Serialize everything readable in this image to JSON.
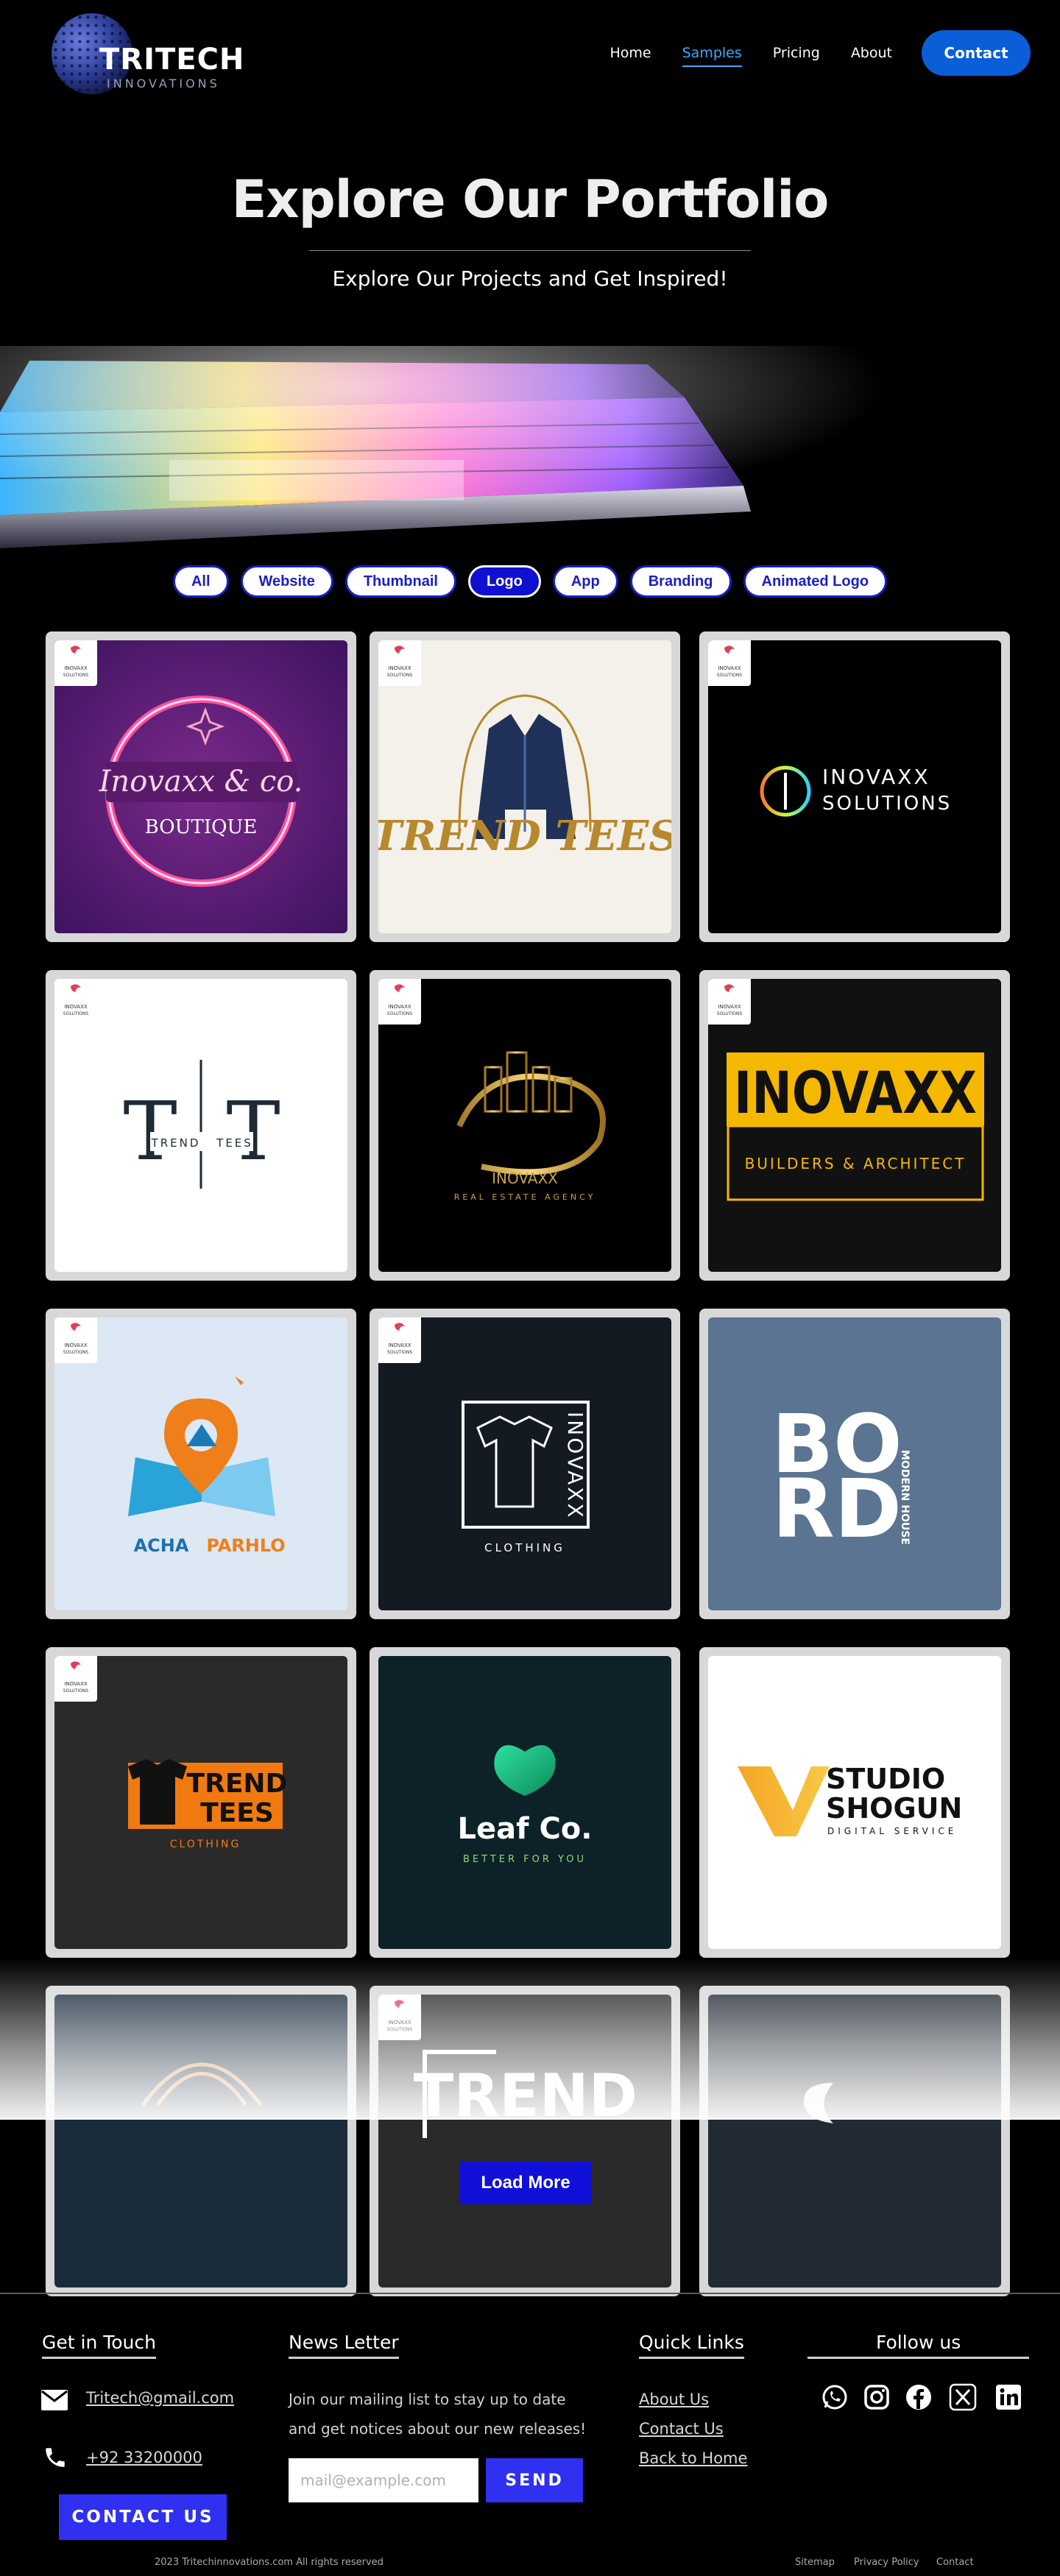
{
  "brand": {
    "name": "TRITECH",
    "sub": "INNOVATIONS"
  },
  "nav": {
    "home": "Home",
    "samples": "Samples",
    "pricing": "Pricing",
    "about": "About",
    "contact": "Contact"
  },
  "hero": {
    "title": "Explore Our Portfolio",
    "subtitle": "Explore Our Projects and Get Inspired!"
  },
  "filters": [
    "All",
    "Website",
    "Thumbnail",
    "Logo",
    "App",
    "Branding",
    "Animated Logo"
  ],
  "active_filter": "Logo",
  "watermark": {
    "line1": "INOVAXX",
    "line2": "SOLUTIONS"
  },
  "portfolio": {
    "c1": {
      "script": "Inovaxx & co.",
      "word": "BOUTIQUE"
    },
    "c2": {
      "word": "TREND TEES"
    },
    "c3": {
      "line1": "INOVAXX",
      "line2": "SOLUTIONS"
    },
    "c4": {
      "left": "TREND",
      "right": "TEES"
    },
    "c5": {
      "line1": "INOVAXX",
      "line2": "REAL ESTATE AGENCY"
    },
    "c6": {
      "line1": "INOVAXX",
      "line2": "BUILDERS & ARCHITECT"
    },
    "c7": {
      "left": "ACHA",
      "right": "PARHLO"
    },
    "c8": {
      "vertical": "INOVAXX",
      "word": "CLOTHING"
    },
    "c9": {
      "l1": "BO",
      "l2": "RD",
      "side": "MODERN HOUSE"
    },
    "c10": {
      "l1": "TREND",
      "l2": "TEES",
      "word": "CLOTHING"
    },
    "c11": {
      "name": "Leaf Co.",
      "tag": "BETTER FOR YOU"
    },
    "c12": {
      "l1": "STUDIO",
      "l2": "SHOGUN",
      "tag": "DIGITAL SERVICE"
    },
    "c14": {
      "word": "TREND"
    }
  },
  "load_more": "Load More",
  "footer": {
    "touch_title": "Get in Touch",
    "email": "Tritech@gmail.com",
    "phone": "+92 33200000",
    "contact_us": "CONTACT US",
    "news_title": "News Letter",
    "news_text_1": "Join our mailing list to stay up to date",
    "news_text_2": "and get notices about our new releases!",
    "email_placeholder": "mail@example.com",
    "send": "SEND",
    "quick_title": "Quick Links",
    "about_us": "About Us",
    "contact_link": "Contact Us",
    "back_home": "Back to Home",
    "follow_title": "Follow us",
    "copyright": "2023 Tritechinnovations.com All rights reserved",
    "sitemap": "Sitemap",
    "privacy": "Privacy Policy",
    "contact_bottom": "Contact"
  },
  "colors": {
    "accent": "#0a5ed8",
    "button_blue": "#1010d8",
    "send_blue": "#3030f0",
    "nav_active": "#3da9ff"
  },
  "icons": [
    "mail-icon",
    "phone-icon",
    "whatsapp-icon",
    "instagram-icon",
    "facebook-icon",
    "x-icon",
    "linkedin-icon"
  ]
}
